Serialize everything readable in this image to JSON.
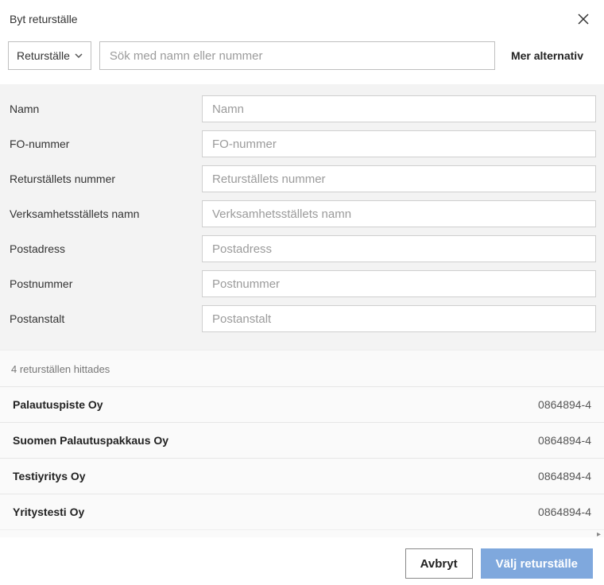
{
  "modal": {
    "title": "Byt returställe"
  },
  "searchRow": {
    "dropdownLabel": "Returställe",
    "searchPlaceholder": "Sök med namn eller nummer",
    "moreLabel": "Mer alternativ"
  },
  "filters": [
    {
      "label": "Namn",
      "placeholder": "Namn"
    },
    {
      "label": "FO-nummer",
      "placeholder": "FO-nummer"
    },
    {
      "label": "Returställets nummer",
      "placeholder": "Returställets nummer"
    },
    {
      "label": "Verksamhetsställets namn",
      "placeholder": "Verksamhetsställets namn"
    },
    {
      "label": "Postadress",
      "placeholder": "Postadress"
    },
    {
      "label": "Postnummer",
      "placeholder": "Postnummer"
    },
    {
      "label": "Postanstalt",
      "placeholder": "Postanstalt"
    }
  ],
  "results": {
    "countText": "4 returställen hittades",
    "items": [
      {
        "name": "Palautuspiste Oy",
        "id": "0864894-4"
      },
      {
        "name": "Suomen Palautuspakkaus Oy",
        "id": "0864894-4"
      },
      {
        "name": "Testiyritys Oy",
        "id": "0864894-4"
      },
      {
        "name": "Yritystesti Oy",
        "id": "0864894-4"
      }
    ]
  },
  "actions": {
    "cancel": "Avbryt",
    "select": "Välj returställe"
  }
}
